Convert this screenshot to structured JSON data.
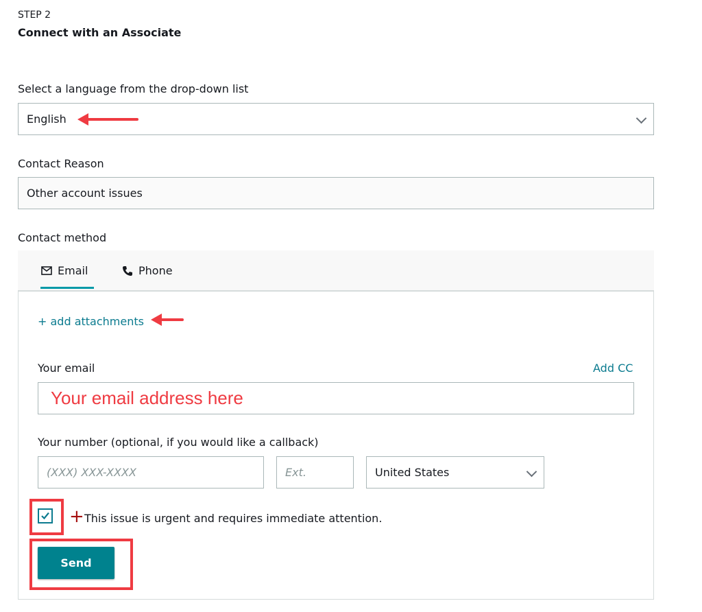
{
  "header": {
    "step": "STEP 2",
    "title": "Connect with an Associate"
  },
  "language": {
    "label": "Select a language from the drop-down list",
    "selected": "English"
  },
  "contact_reason": {
    "label": "Contact Reason",
    "value": "Other account issues"
  },
  "contact_method": {
    "label": "Contact method",
    "tabs": [
      {
        "label": "Email",
        "icon": "envelope-icon",
        "active": true
      },
      {
        "label": "Phone",
        "icon": "phone-icon",
        "active": false
      }
    ]
  },
  "email_panel": {
    "add_attachments": "+ add attachments",
    "email_label": "Your email",
    "add_cc": "Add CC",
    "email_value": "Your email address here",
    "number_label": "Your number (optional, if you would like a callback)",
    "phone_placeholder": "(XXX) XXX-XXXX",
    "ext_placeholder": "Ext.",
    "country_selected": "United States",
    "urgent_checked": true,
    "urgent_label": "This issue is urgent and requires immediate attention.",
    "send_label": "Send"
  },
  "colors": {
    "accent": "#0b7b8f",
    "button": "#00828e",
    "annotation": "#ef3b42",
    "urgent_plus": "#a50e0e"
  }
}
